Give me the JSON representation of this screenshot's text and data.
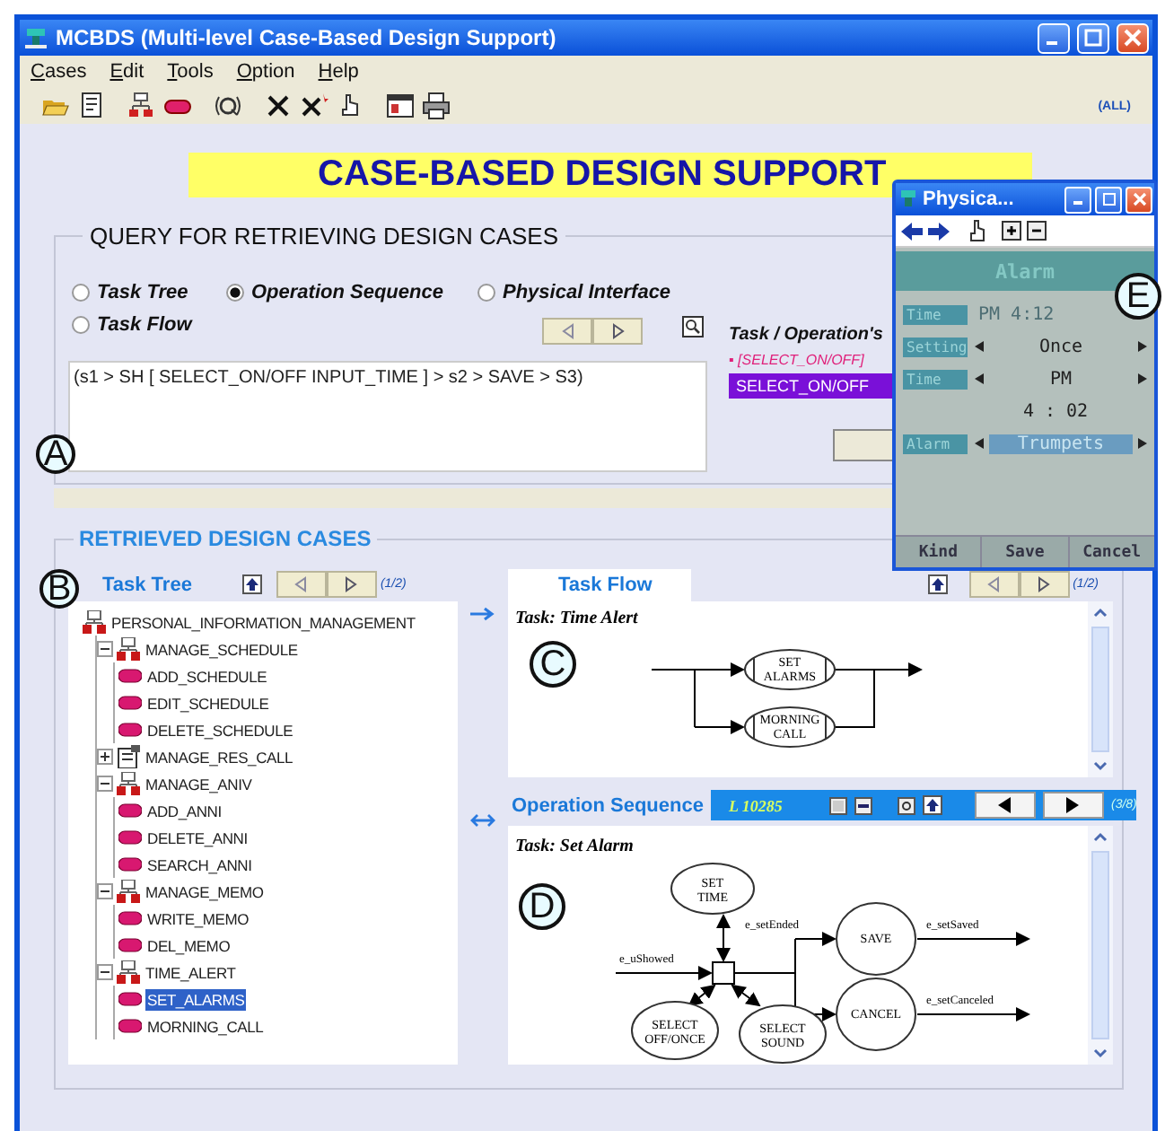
{
  "window": {
    "title": "MCBDS (Multi-level Case-Based Design Support)"
  },
  "menu": [
    {
      "label": "Cases"
    },
    {
      "label": "Edit"
    },
    {
      "label": "Tools"
    },
    {
      "label": "Option"
    },
    {
      "label": "Help"
    }
  ],
  "toolbar": {
    "scope": "(ALL)"
  },
  "banner": "CASE-BASED DESIGN SUPPORT",
  "query": {
    "title": "QUERY FOR RETRIEVING DESIGN CASES",
    "callout": "A",
    "options": [
      {
        "label": "Task Tree",
        "selected": false
      },
      {
        "label": "Operation Sequence",
        "selected": true
      },
      {
        "label": "Physical Interface",
        "selected": false
      },
      {
        "label": "Task Flow",
        "selected": false
      }
    ],
    "expression": "(s1 > SH [ SELECT_ON/OFF INPUT_TIME ] > s2 > SAVE > S3)",
    "side_title": "Task / Operation's",
    "marked_item": "▪ [SELECT_ON/OFF]",
    "selected_item": "SELECT_ON/OFF"
  },
  "cases": {
    "title": "RETRIEVED DESIGN CASES",
    "callout": "B",
    "tree_panel": {
      "tab": {
        "label": "Task Tree",
        "selected": false
      },
      "page": "(1/2)",
      "tree": [
        {
          "label": "PERSONAL_INFORMATION_MANAGEMENT",
          "kind": "group",
          "selected": false,
          "children": [
            {
              "label": "MANAGE_SCHEDULE",
              "kind": "group",
              "expanded": true,
              "selected": false,
              "children": [
                {
                  "label": "ADD_SCHEDULE",
                  "kind": "task",
                  "selected": false
                },
                {
                  "label": "EDIT_SCHEDULE",
                  "kind": "task",
                  "selected": false
                },
                {
                  "label": "DELETE_SCHEDULE",
                  "kind": "task",
                  "selected": false
                }
              ]
            },
            {
              "label": "MANAGE_RES_CALL",
              "kind": "call",
              "expanded": false,
              "selected": false
            },
            {
              "label": "MANAGE_ANIV",
              "kind": "group",
              "expanded": true,
              "selected": false,
              "children": [
                {
                  "label": "ADD_ANNI",
                  "kind": "task",
                  "selected": false
                },
                {
                  "label": "DELETE_ANNI",
                  "kind": "task",
                  "selected": false
                },
                {
                  "label": "SEARCH_ANNI",
                  "kind": "task",
                  "selected": false
                }
              ]
            },
            {
              "label": "MANAGE_MEMO",
              "kind": "group",
              "expanded": true,
              "selected": false,
              "children": [
                {
                  "label": "WRITE_MEMO",
                  "kind": "task",
                  "selected": false
                },
                {
                  "label": "DEL_MEMO",
                  "kind": "task",
                  "selected": false
                }
              ]
            },
            {
              "label": "TIME_ALERT",
              "kind": "group",
              "expanded": true,
              "selected": false,
              "children": [
                {
                  "label": "SET_ALARMS",
                  "kind": "task",
                  "selected": true
                },
                {
                  "label": "MORNING_CALL",
                  "kind": "task",
                  "selected": false
                }
              ]
            }
          ]
        }
      ]
    },
    "flow_panel": {
      "tab": {
        "label": "Task Flow",
        "selected": true
      },
      "page": "(1/2)",
      "task": "Task: Time Alert",
      "callout": "C",
      "nodes": [
        {
          "label": "SET ALARMS"
        },
        {
          "label": "MORNING CALL"
        }
      ]
    },
    "sequence_panel": {
      "tab": {
        "label": "Operation Sequence",
        "selected": false
      },
      "code": "L 10285",
      "page": "(3/8)",
      "task": "Task: Set Alarm",
      "callout": "D",
      "states": [
        {
          "label": "SET TIME"
        },
        {
          "label": "SAVE"
        },
        {
          "label": "CANCEL"
        },
        {
          "label": "SELECT OFF/ONCE"
        },
        {
          "label": "SELECT SOUND"
        }
      ],
      "events": [
        "e_uShowed",
        "e_setEnded",
        "e_setSaved",
        "e_setCanceled"
      ]
    }
  },
  "physical_window": {
    "title": "Physica...",
    "screen_title": "Alarm",
    "callout": "E",
    "rows": [
      {
        "kind": "readout",
        "label": "Time",
        "value": "PM  4:12"
      },
      {
        "kind": "spinner",
        "label": "Setting",
        "value": "Once",
        "highlighted": false
      },
      {
        "kind": "spinner",
        "label": "Time",
        "value": "PM",
        "highlighted": false
      },
      {
        "kind": "value",
        "value": "4 : 02"
      },
      {
        "kind": "spinner",
        "label": "Alarm",
        "value": "Trumpets",
        "highlighted": true
      }
    ],
    "softkeys": [
      "Kind",
      "Save",
      "Cancel"
    ]
  }
}
